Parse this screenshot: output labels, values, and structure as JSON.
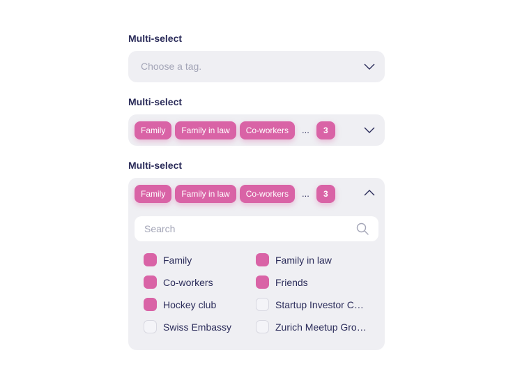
{
  "select1": {
    "label": "Multi-select",
    "placeholder": "Choose a tag."
  },
  "select2": {
    "label": "Multi-select",
    "chips": [
      "Family",
      "Family in law",
      "Co-workers"
    ],
    "ellipsis": "...",
    "more_count": "3"
  },
  "select3": {
    "label": "Multi-select",
    "chips": [
      "Family",
      "Family in law",
      "Co-workers"
    ],
    "ellipsis": "...",
    "more_count": "3",
    "search_placeholder": "Search",
    "options": [
      {
        "label": "Family",
        "checked": true
      },
      {
        "label": "Family in law",
        "checked": true
      },
      {
        "label": "Co-workers",
        "checked": true
      },
      {
        "label": "Friends",
        "checked": true
      },
      {
        "label": "Hockey club",
        "checked": true
      },
      {
        "label": "Startup Investor Col...",
        "checked": false
      },
      {
        "label": "Swiss Embassy",
        "checked": false
      },
      {
        "label": "Zurich Meetup Grou...",
        "checked": false
      }
    ]
  },
  "icons": {
    "chevron_down": "chevron-down-icon",
    "chevron_up": "chevron-up-icon",
    "search": "search-icon"
  },
  "colors": {
    "accent": "#d963a6",
    "text": "#2b2c5a",
    "placeholder": "#a3a5b7",
    "field_bg": "#efeff3"
  }
}
